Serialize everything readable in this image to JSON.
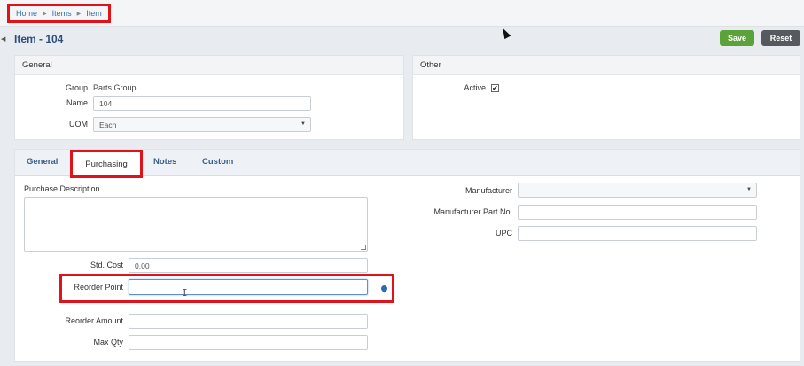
{
  "breadcrumb": {
    "items": [
      "Home",
      "Items",
      "Item"
    ]
  },
  "page": {
    "title": "Item - 104"
  },
  "toolbar": {
    "save_label": "Save",
    "reset_label": "Reset"
  },
  "general_panel": {
    "heading": "General",
    "group_label": "Group",
    "group_value": "Parts Group",
    "name_label": "Name",
    "name_value": "104",
    "uom_label": "UOM",
    "uom_value": "Each"
  },
  "other_panel": {
    "heading": "Other",
    "active_label": "Active",
    "active_checked": true,
    "check_glyph": "✔"
  },
  "tabs": [
    {
      "label": "General",
      "active": false
    },
    {
      "label": "Purchasing",
      "active": true
    },
    {
      "label": "Notes",
      "active": false
    },
    {
      "label": "Custom",
      "active": false
    }
  ],
  "purchasing": {
    "description_label": "Purchase Description",
    "description_value": "",
    "std_cost_label": "Std. Cost",
    "std_cost_placeholder": "0.00",
    "reorder_point_label": "Reorder Point",
    "reorder_point_value": "",
    "reorder_amount_label": "Reorder Amount",
    "reorder_amount_value": "",
    "max_qty_label": "Max Qty",
    "max_qty_value": "",
    "manufacturer_label": "Manufacturer",
    "manufacturer_value": "",
    "manufacturer_part_label": "Manufacturer Part No.",
    "manufacturer_part_value": "",
    "upc_label": "UPC",
    "upc_value": ""
  },
  "colors": {
    "accent_blue": "#3a6ea5",
    "save_green": "#5ba23b",
    "reset_gray": "#555a5f",
    "highlight_red": "#e0131a"
  },
  "icons": {
    "location_pin": "map-pin-icon",
    "caret": "▼"
  }
}
